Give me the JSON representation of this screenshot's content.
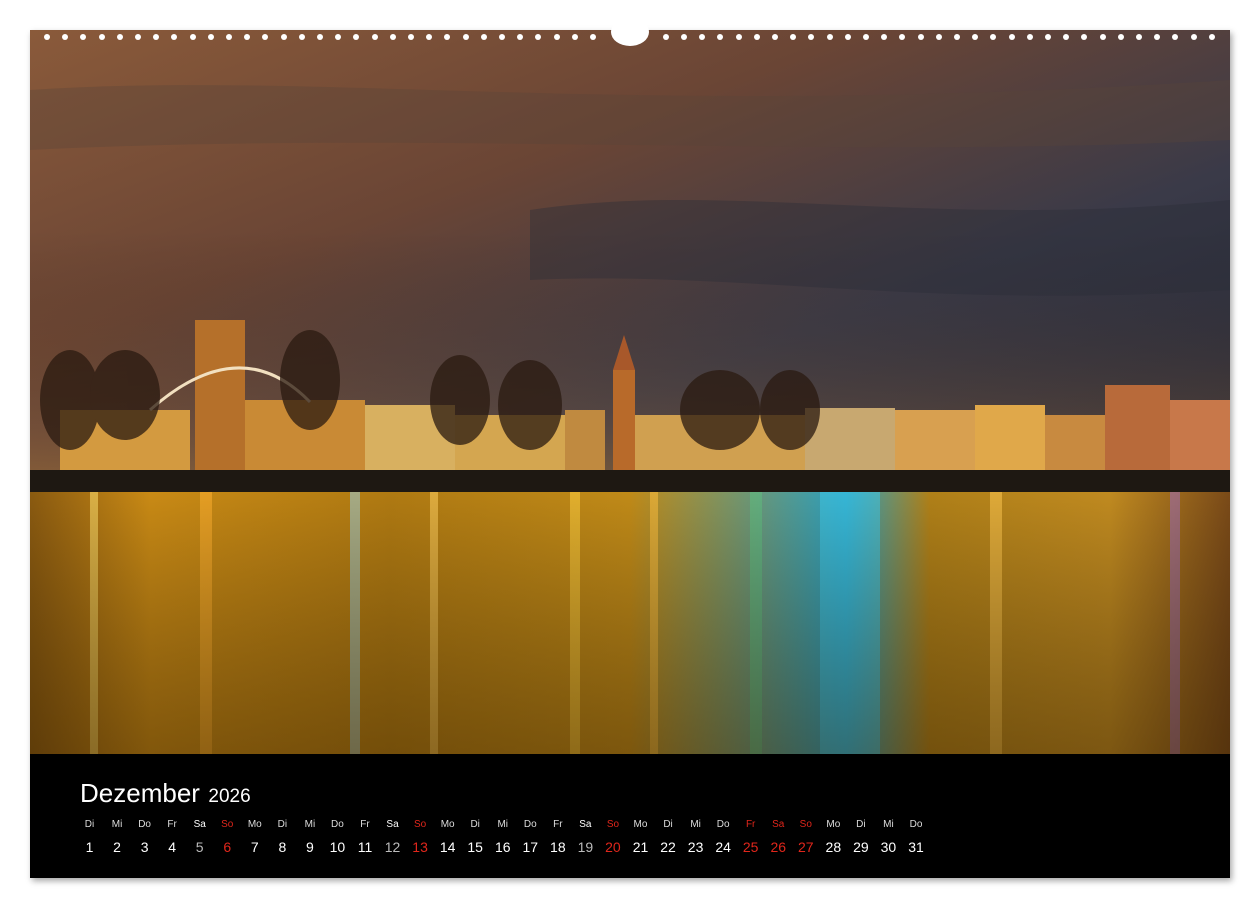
{
  "calendar": {
    "month": "Dezember",
    "year": "2026",
    "days": [
      {
        "name": "Di",
        "date": "1",
        "type": "weekday"
      },
      {
        "name": "Mi",
        "date": "2",
        "type": "weekday"
      },
      {
        "name": "Do",
        "date": "3",
        "type": "weekday"
      },
      {
        "name": "Fr",
        "date": "4",
        "type": "weekday"
      },
      {
        "name": "Sa",
        "date": "5",
        "type": "sat"
      },
      {
        "name": "So",
        "date": "6",
        "type": "sun"
      },
      {
        "name": "Mo",
        "date": "7",
        "type": "weekday"
      },
      {
        "name": "Di",
        "date": "8",
        "type": "weekday"
      },
      {
        "name": "Mi",
        "date": "9",
        "type": "weekday"
      },
      {
        "name": "Do",
        "date": "10",
        "type": "weekday"
      },
      {
        "name": "Fr",
        "date": "11",
        "type": "weekday"
      },
      {
        "name": "Sa",
        "date": "12",
        "type": "sat"
      },
      {
        "name": "So",
        "date": "13",
        "type": "sun"
      },
      {
        "name": "Mo",
        "date": "14",
        "type": "weekday"
      },
      {
        "name": "Di",
        "date": "15",
        "type": "weekday"
      },
      {
        "name": "Mi",
        "date": "16",
        "type": "weekday"
      },
      {
        "name": "Do",
        "date": "17",
        "type": "weekday"
      },
      {
        "name": "Fr",
        "date": "18",
        "type": "weekday"
      },
      {
        "name": "Sa",
        "date": "19",
        "type": "sat"
      },
      {
        "name": "So",
        "date": "20",
        "type": "sun"
      },
      {
        "name": "Mo",
        "date": "21",
        "type": "weekday"
      },
      {
        "name": "Di",
        "date": "22",
        "type": "weekday"
      },
      {
        "name": "Mi",
        "date": "23",
        "type": "weekday"
      },
      {
        "name": "Do",
        "date": "24",
        "type": "weekday"
      },
      {
        "name": "Fr",
        "date": "25",
        "type": "holiday"
      },
      {
        "name": "Sa",
        "date": "26",
        "type": "holiday"
      },
      {
        "name": "So",
        "date": "27",
        "type": "sun"
      },
      {
        "name": "Mo",
        "date": "28",
        "type": "weekday"
      },
      {
        "name": "Di",
        "date": "29",
        "type": "weekday"
      },
      {
        "name": "Mi",
        "date": "30",
        "type": "weekday"
      },
      {
        "name": "Do",
        "date": "31",
        "type": "weekday"
      }
    ]
  },
  "colors": {
    "holiday": "#e0261b",
    "calendar_bg": "#000000",
    "sky_warm": "#7a4a2e",
    "sky_cool": "#2a2f3d",
    "water_gold": "#c98a12"
  }
}
